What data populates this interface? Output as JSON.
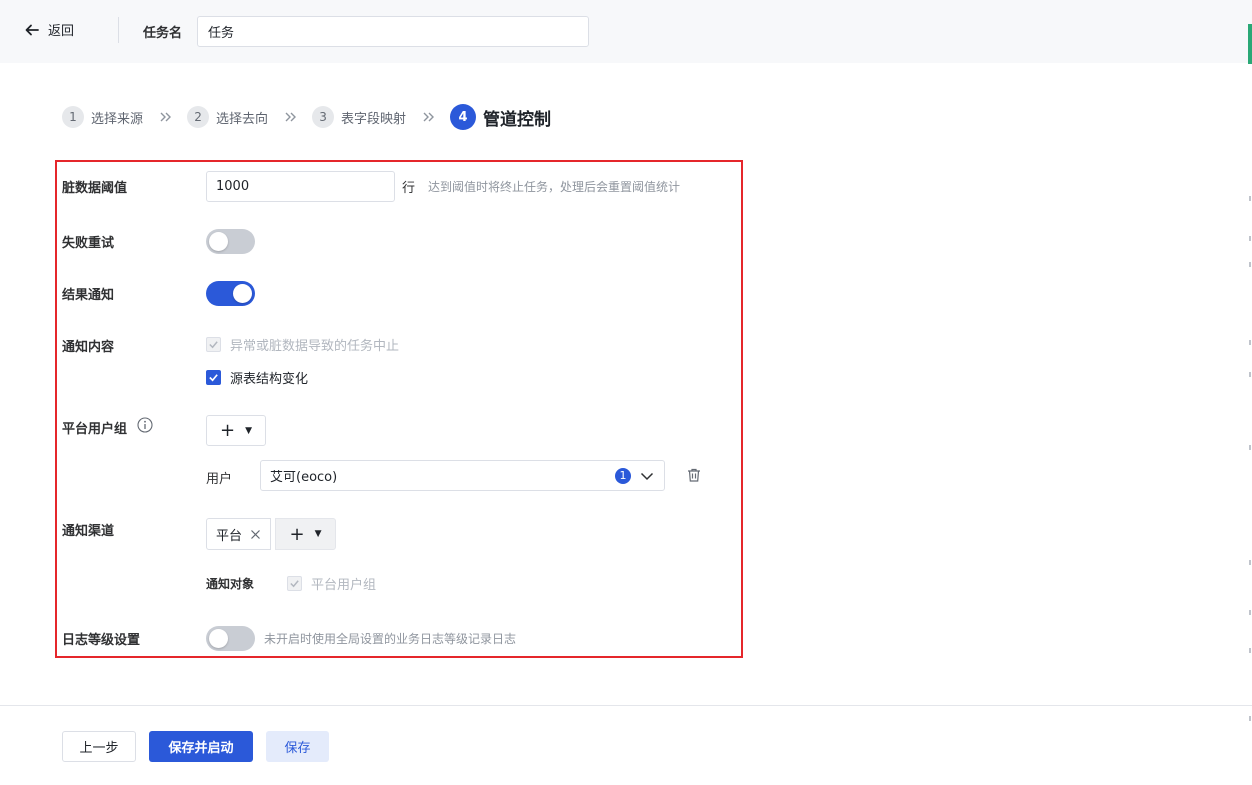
{
  "header": {
    "back_label": "返回",
    "task_name_label": "任务名",
    "task_name_value": "任务"
  },
  "steps": [
    {
      "num": "1",
      "label": "选择来源"
    },
    {
      "num": "2",
      "label": "选择去向"
    },
    {
      "num": "3",
      "label": "表字段映射"
    },
    {
      "num": "4",
      "label": "管道控制"
    }
  ],
  "form": {
    "dirty_threshold": {
      "label": "脏数据阈值",
      "value": "1000",
      "unit": "行",
      "hint": "达到阈值时将终止任务，处理后会重置阈值统计"
    },
    "fail_retry": {
      "label": "失败重试",
      "enabled": false
    },
    "result_notify": {
      "label": "结果通知",
      "enabled": true
    },
    "notify_content": {
      "label": "通知内容",
      "options": [
        {
          "text": "异常或脏数据导致的任务中止",
          "checked": true,
          "disabled": true
        },
        {
          "text": "源表结构变化",
          "checked": true,
          "disabled": false
        }
      ]
    },
    "platform_user_group": {
      "label": "平台用户组",
      "add_symbol": "+",
      "user_label": "用户",
      "user_value": "艾可(eoco)",
      "user_count": "1"
    },
    "notify_channel": {
      "label": "通知渠道",
      "tag": "平台",
      "add_symbol": "+",
      "target_label": "通知对象",
      "target_option": "平台用户组"
    },
    "log_level": {
      "label": "日志等级设置",
      "enabled": false,
      "hint": "未开启时使用全局设置的业务日志等级记录日志"
    }
  },
  "footer": {
    "prev_label": "上一步",
    "save_start_label": "保存并启动",
    "save_label": "保存"
  },
  "colors": {
    "primary": "#2b59d9",
    "highlight_border": "#e5262b"
  }
}
